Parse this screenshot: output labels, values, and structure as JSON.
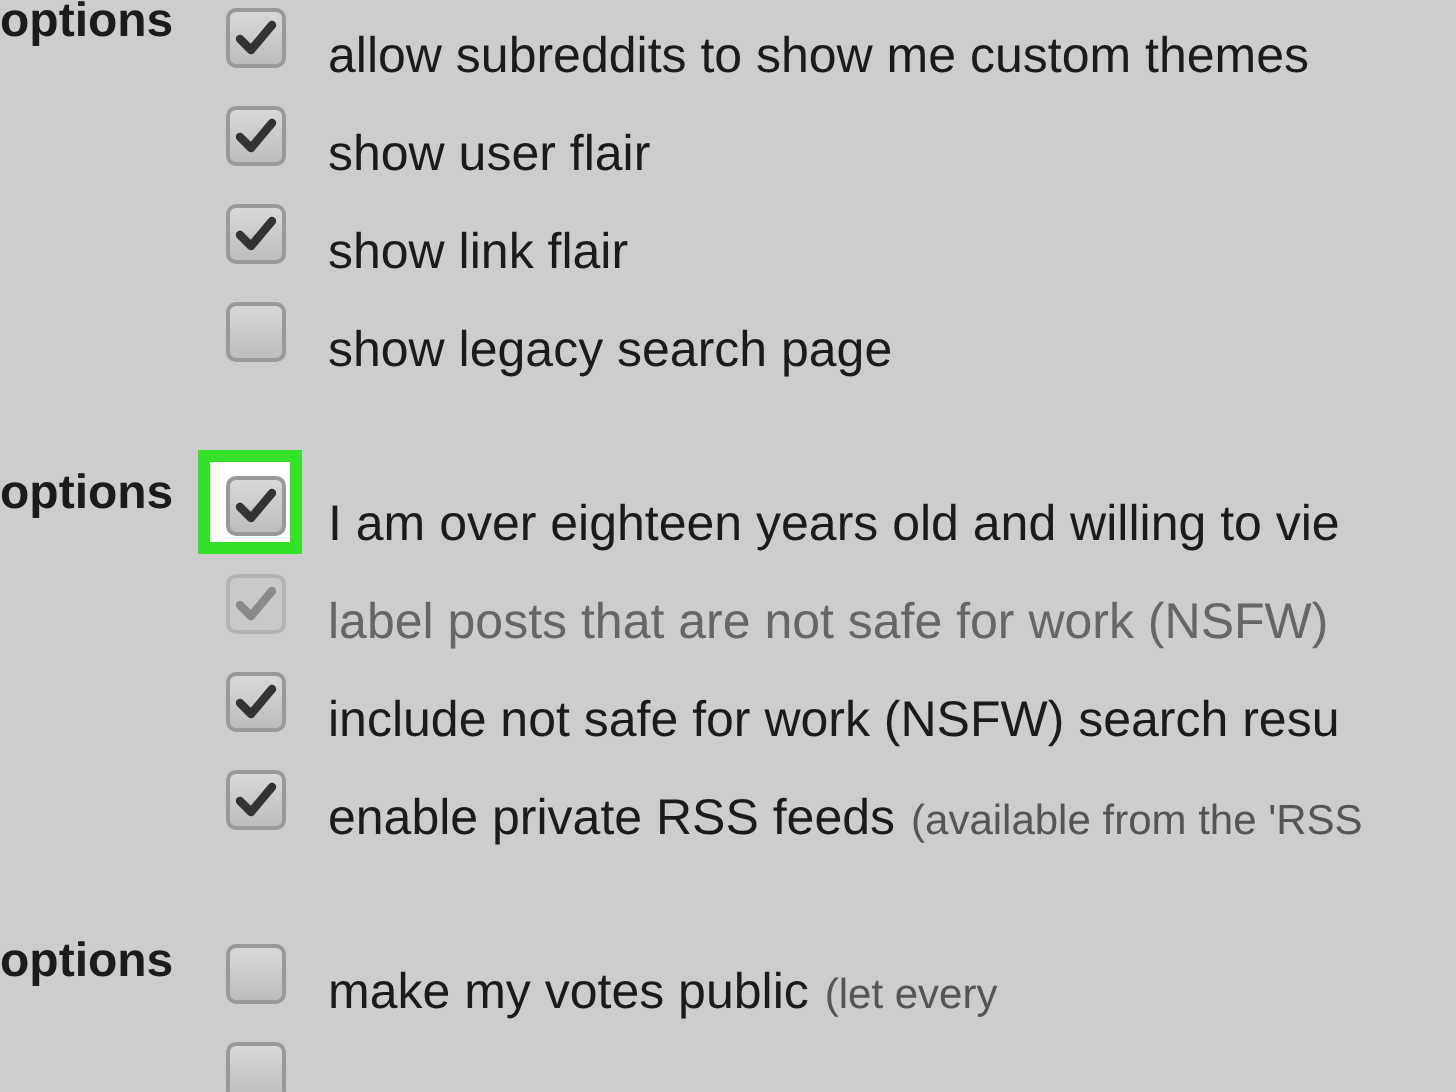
{
  "sections": [
    {
      "heading": "options",
      "items": [
        {
          "label": "allow subreddits to show me custom themes",
          "checked": true,
          "disabled": false,
          "highlighted": false
        },
        {
          "label": "show user flair",
          "checked": true,
          "disabled": false,
          "highlighted": false
        },
        {
          "label": "show link flair",
          "checked": true,
          "disabled": false,
          "highlighted": false
        },
        {
          "label": "show legacy search page",
          "checked": false,
          "disabled": false,
          "highlighted": false
        }
      ]
    },
    {
      "heading": "options",
      "items": [
        {
          "label": "I am over eighteen years old and willing to vie",
          "checked": true,
          "disabled": false,
          "highlighted": true
        },
        {
          "label": "label posts that are not safe for work (NSFW)",
          "checked": true,
          "disabled": true,
          "highlighted": false
        },
        {
          "label": "include not safe for work (NSFW) search resu",
          "checked": true,
          "disabled": false,
          "highlighted": false
        },
        {
          "label": "enable private RSS feeds",
          "note": "(available from the 'RSS",
          "checked": true,
          "disabled": false,
          "highlighted": false
        }
      ]
    },
    {
      "heading": "options",
      "items": [
        {
          "label": "make my votes public",
          "note": "(let every",
          "checked": false,
          "disabled": false,
          "highlighted": false
        },
        {
          "checked": false,
          "disabled": false,
          "highlighted": false
        }
      ]
    }
  ]
}
